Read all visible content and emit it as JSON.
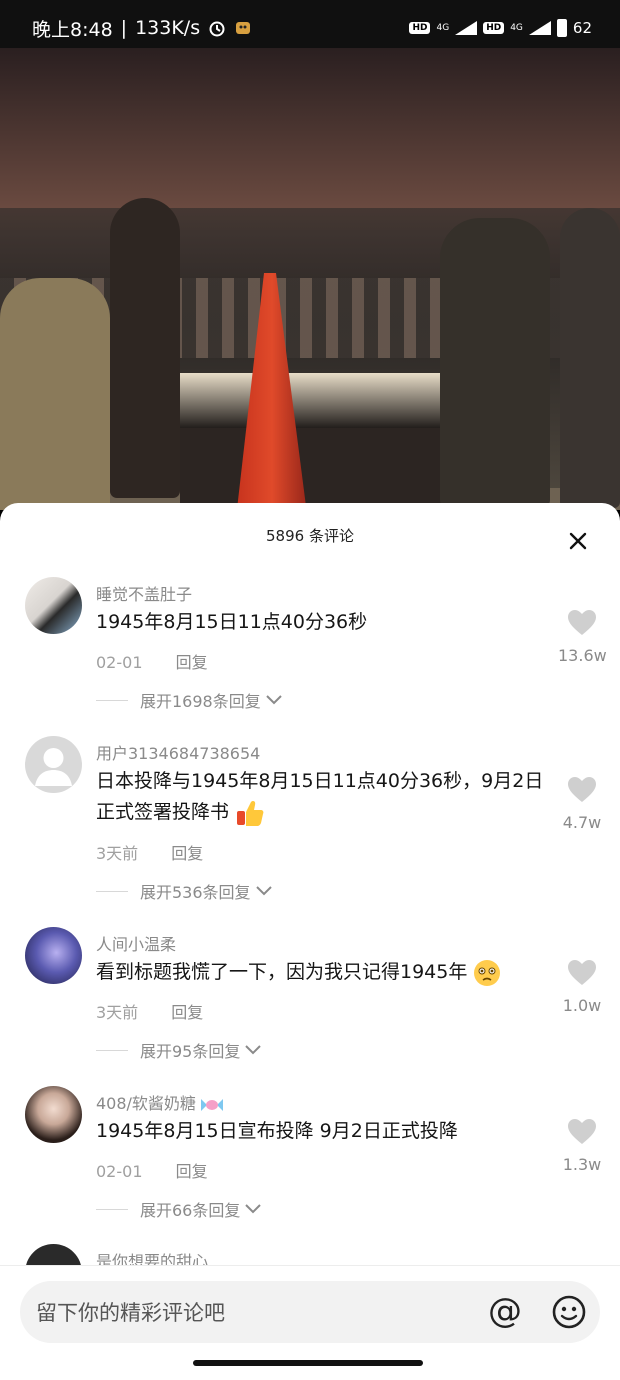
{
  "status_bar": {
    "time": "晚上8:48",
    "speed": "133K/s",
    "hd1": "HD",
    "net1": "4G",
    "hd2": "HD",
    "net2": "4G",
    "battery": "62"
  },
  "sheet": {
    "title": "5896 条评论"
  },
  "comments": [
    {
      "name": "睡觉不盖肚子",
      "text": "1945年8月15日11点40分36秒",
      "date": "02-01",
      "reply": "回复",
      "likes": "13.6w",
      "expand": "展开1698条回复"
    },
    {
      "name": "用户3134684738654",
      "text": "日本投降与1945年8月15日11点40分36秒，9月2日正式签署投降书",
      "emoji": "thumbs-up-emoji",
      "date": "3天前",
      "reply": "回复",
      "likes": "4.7w",
      "expand": "展开536条回复"
    },
    {
      "name": "人间小温柔",
      "text": "看到标题我慌了一下，因为我只记得1945年",
      "emoji": "worried-face-emoji",
      "date": "3天前",
      "reply": "回复",
      "likes": "1.0w",
      "expand": "展开95条回复"
    },
    {
      "name": "408/软酱奶糖",
      "name_emoji": "candy-emoji",
      "text": "1945年8月15日宣布投降 9月2日正式投降",
      "date": "02-01",
      "reply": "回复",
      "likes": "1.3w",
      "expand": "展开66条回复"
    },
    {
      "name": "是你想要的甜心"
    }
  ],
  "input": {
    "placeholder": "留下你的精彩评论吧",
    "at_symbol": "@"
  },
  "colors": {
    "like_heart": "#cfcfcf",
    "muted_text": "#8a8a8a"
  }
}
